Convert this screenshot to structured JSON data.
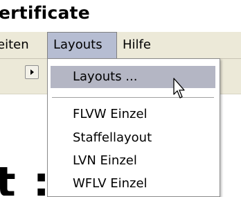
{
  "window": {
    "title_fragment": "ertificate"
  },
  "menubar": {
    "items": [
      {
        "label": "eiten"
      },
      {
        "label": "Layouts"
      },
      {
        "label": "Hilfe"
      }
    ]
  },
  "toolbar": {
    "nav_button_icon": "triangle-right-icon"
  },
  "dropdown": {
    "items": [
      {
        "label": "Layouts ..."
      },
      {
        "label": "FLVW Einzel"
      },
      {
        "label": "Staffellayout"
      },
      {
        "label": "LVN Einzel"
      },
      {
        "label": "WFLV Einzel"
      }
    ]
  },
  "content": {
    "big_text": "t                    ::"
  },
  "colors": {
    "menubar_bg": "#ece9d8",
    "menu_hover": "#b6bdd2",
    "dropdown_hover": "#b4b6c4"
  },
  "cursor": {
    "icon": "arrow-cursor-icon"
  }
}
